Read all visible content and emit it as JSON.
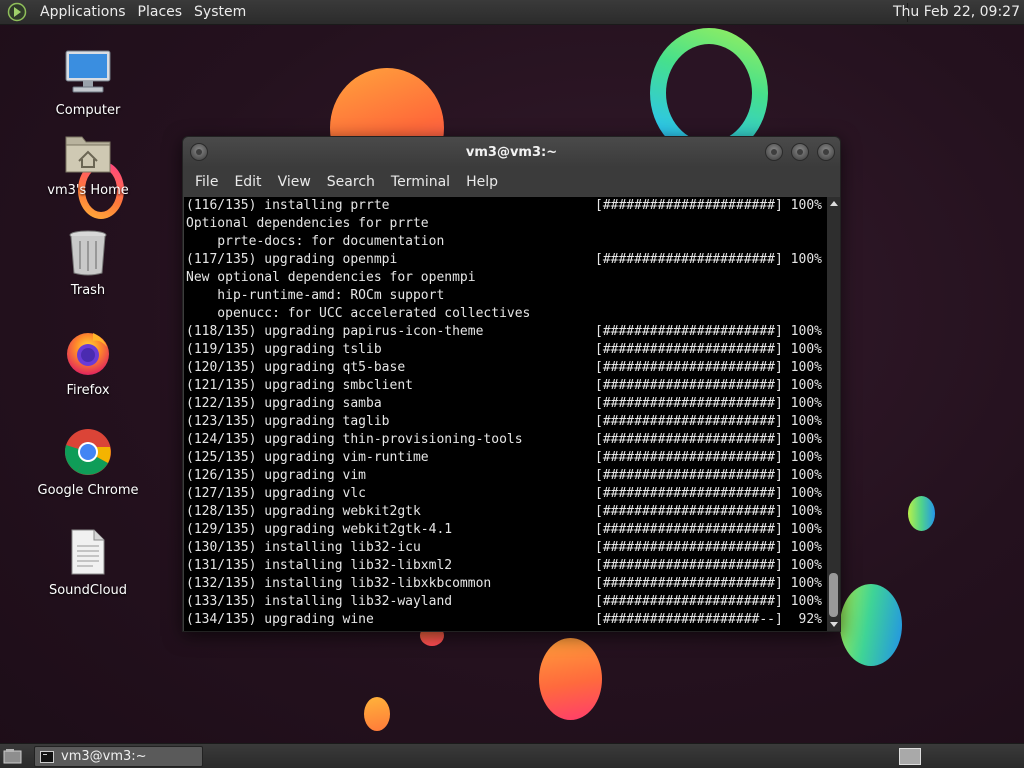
{
  "top_panel": {
    "menus": [
      "Applications",
      "Places",
      "System"
    ],
    "clock": "Thu Feb 22, 09:27"
  },
  "desktop_icons": [
    {
      "label": "Computer",
      "icon": "computer-icon"
    },
    {
      "label": "vm3's Home",
      "icon": "home-folder-icon"
    },
    {
      "label": "Trash",
      "icon": "trash-icon"
    },
    {
      "label": "Firefox",
      "icon": "firefox-icon"
    },
    {
      "label": "Google Chrome",
      "icon": "chrome-icon"
    },
    {
      "label": "SoundCloud",
      "icon": "document-icon"
    }
  ],
  "window": {
    "title": "vm3@vm3:~",
    "menu": [
      "File",
      "Edit",
      "View",
      "Search",
      "Terminal",
      "Help"
    ]
  },
  "terminal_lines": [
    {
      "text": "(116/135) installing prrte",
      "bar": "[######################] 100%"
    },
    {
      "text": "Optional dependencies for prrte",
      "bar": ""
    },
    {
      "text": "    prrte-docs: for documentation",
      "bar": ""
    },
    {
      "text": "(117/135) upgrading openmpi",
      "bar": "[######################] 100%"
    },
    {
      "text": "New optional dependencies for openmpi",
      "bar": ""
    },
    {
      "text": "    hip-runtime-amd: ROCm support",
      "bar": ""
    },
    {
      "text": "    openucc: for UCC accelerated collectives",
      "bar": ""
    },
    {
      "text": "(118/135) upgrading papirus-icon-theme",
      "bar": "[######################] 100%"
    },
    {
      "text": "(119/135) upgrading tslib",
      "bar": "[######################] 100%"
    },
    {
      "text": "(120/135) upgrading qt5-base",
      "bar": "[######################] 100%"
    },
    {
      "text": "(121/135) upgrading smbclient",
      "bar": "[######################] 100%"
    },
    {
      "text": "(122/135) upgrading samba",
      "bar": "[######################] 100%"
    },
    {
      "text": "(123/135) upgrading taglib",
      "bar": "[######################] 100%"
    },
    {
      "text": "(124/135) upgrading thin-provisioning-tools",
      "bar": "[######################] 100%"
    },
    {
      "text": "(125/135) upgrading vim-runtime",
      "bar": "[######################] 100%"
    },
    {
      "text": "(126/135) upgrading vim",
      "bar": "[######################] 100%"
    },
    {
      "text": "(127/135) upgrading vlc",
      "bar": "[######################] 100%"
    },
    {
      "text": "(128/135) upgrading webkit2gtk",
      "bar": "[######################] 100%"
    },
    {
      "text": "(129/135) upgrading webkit2gtk-4.1",
      "bar": "[######################] 100%"
    },
    {
      "text": "(130/135) installing lib32-icu",
      "bar": "[######################] 100%"
    },
    {
      "text": "(131/135) installing lib32-libxml2",
      "bar": "[######################] 100%"
    },
    {
      "text": "(132/135) installing lib32-libxkbcommon",
      "bar": "[######################] 100%"
    },
    {
      "text": "(133/135) installing lib32-wayland",
      "bar": "[######################] 100%"
    },
    {
      "text": "(134/135) upgrading wine",
      "bar": "[####################--]  92%"
    }
  ],
  "taskbar": {
    "task_label": "vm3@vm3:~"
  },
  "colors": {
    "wallpaper": "#25121f",
    "terminal_bg": "#000000",
    "terminal_fg": "#e6e6e6",
    "panel": "#2f2f2f"
  }
}
